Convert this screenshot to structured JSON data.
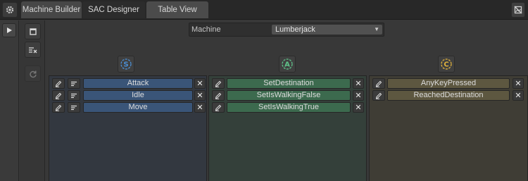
{
  "tabs": [
    {
      "label": "Machine Builder"
    },
    {
      "label": "SAC Designer"
    },
    {
      "label": "Table View"
    }
  ],
  "toolbar": {
    "settings_icon": "gear-icon",
    "right_icon": "image-off-icon",
    "play_icon": "play-icon"
  },
  "sidebar": {
    "buttons": [
      {
        "icon": "window-icon"
      },
      {
        "icon": "clear-list-icon"
      },
      {
        "icon": "refresh-icon"
      }
    ]
  },
  "machine": {
    "label": "Machine",
    "selected": "Lumberjack"
  },
  "columns": [
    {
      "badge": "S",
      "color": "#4a8fd6",
      "items": [
        "Attack",
        "Idle",
        "Move"
      ]
    },
    {
      "badge": "A",
      "color": "#5fc48a",
      "items": [
        "SetDestination",
        "SetIsWalkingFalse",
        "SetIsWalkingTrue"
      ]
    },
    {
      "badge": "C",
      "color": "#e0b13a",
      "items": [
        "AnyKeyPressed",
        "ReachedDestination"
      ]
    }
  ],
  "close_glyph": "✕"
}
